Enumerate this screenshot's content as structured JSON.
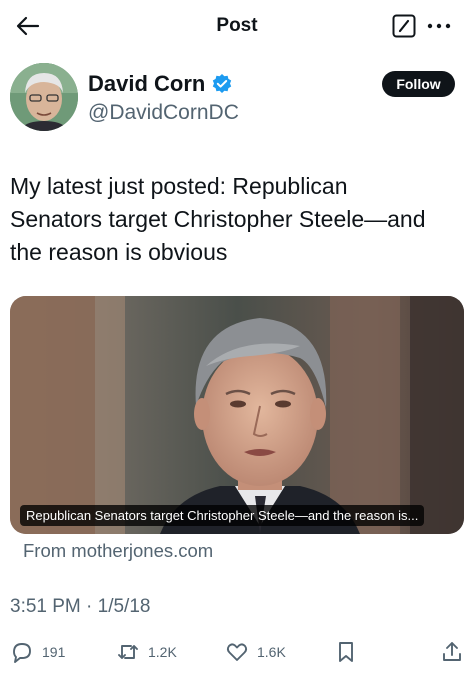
{
  "header": {
    "title": "Post",
    "back_icon": "arrow-left-icon",
    "compose_icon": "compose-icon",
    "more_icon": "more-dots-icon"
  },
  "author": {
    "name": "David Corn",
    "handle": "@DavidCornDC",
    "verified": true,
    "verified_color": "#1d9bf0"
  },
  "follow_label": "Follow",
  "tweet": {
    "lines": [
      "My latest just posted: Republican",
      "Senators target Christopher Steele—and",
      "the reason is obvious"
    ]
  },
  "card": {
    "caption": "Republican Senators target Christopher Steele—and the reason is...",
    "source": "From motherjones.com"
  },
  "timestamp": "3:51 PM · 1/5/18",
  "actions": {
    "replies": "191",
    "reposts": "1.2K",
    "likes": "1.6K"
  },
  "colors": {
    "text": "#0f1419",
    "secondary": "#536471",
    "accent": "#1d9bf0"
  }
}
